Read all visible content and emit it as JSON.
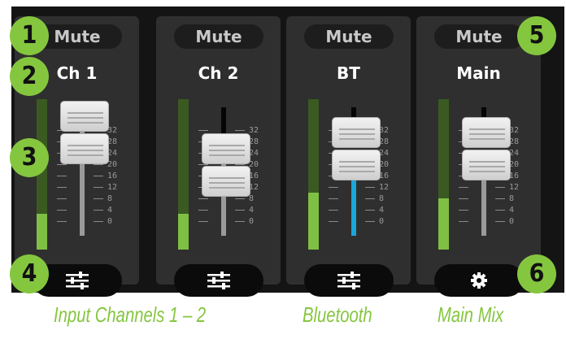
{
  "channels": [
    {
      "mute": "Mute",
      "name": "Ch 1",
      "level": 0.24,
      "control_icon": "sliders-icon"
    },
    {
      "mute": "Mute",
      "name": "Ch 2",
      "level": 0.24,
      "control_icon": "sliders-icon"
    },
    {
      "mute": "Mute",
      "name": "BT",
      "level": 0.38,
      "control_icon": "sliders-icon"
    },
    {
      "mute": "Mute",
      "name": "Main",
      "level": 0.34,
      "control_icon": "gear-icon"
    }
  ],
  "scale_labels": [
    "32",
    "28",
    "24",
    "20",
    "16",
    "12",
    "8",
    "4",
    "0"
  ],
  "badges": [
    "1",
    "2",
    "3",
    "4",
    "5",
    "6"
  ],
  "captions": {
    "inputs": "Input Channels 1 – 2",
    "bluetooth": "Bluetooth",
    "main": "Main Mix"
  },
  "colors": {
    "accent_green": "#85c63f",
    "meter_green": "#7fbf44",
    "bluetooth_blue": "#1aa7d8",
    "panel": "#141414",
    "strip": "#2f2f2f"
  }
}
